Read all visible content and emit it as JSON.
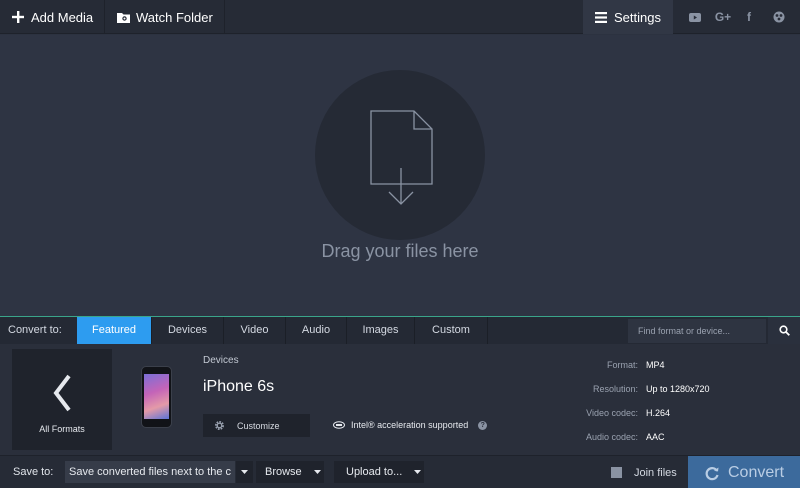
{
  "toolbar": {
    "add_media": "Add Media",
    "watch_folder": "Watch Folder",
    "settings": "Settings",
    "social": [
      "youtube-icon",
      "google-plus-icon",
      "facebook-icon",
      "community-icon"
    ],
    "google_plus_text": "G+",
    "facebook_text": "f"
  },
  "dropzone": {
    "text": "Drag your files here"
  },
  "tabs": {
    "label": "Convert to:",
    "items": [
      "Featured",
      "Devices",
      "Video",
      "Audio",
      "Images",
      "Custom"
    ],
    "active": "Featured",
    "search_placeholder": "Find format or device..."
  },
  "preset": {
    "all_formats": "All Formats",
    "category": "Devices",
    "device": "iPhone 6s",
    "customize": "Customize",
    "intel": "Intel® acceleration supported",
    "help": "?",
    "specs": {
      "format_label": "Format:",
      "format": "MP4",
      "resolution_label": "Resolution:",
      "resolution": "Up to 1280x720",
      "video_codec_label": "Video codec:",
      "video_codec": "H.264",
      "audio_codec_label": "Audio codec:",
      "audio_codec": "AAC"
    }
  },
  "bottom": {
    "save_label": "Save to:",
    "save_value": "Save converted files next to the c",
    "browse": "Browse",
    "upload": "Upload to...",
    "join": "Join files",
    "convert": "Convert"
  },
  "colors": {
    "accent": "#2d9cf0",
    "convert": "#3c6a9c",
    "divider": "#3aa58a"
  }
}
